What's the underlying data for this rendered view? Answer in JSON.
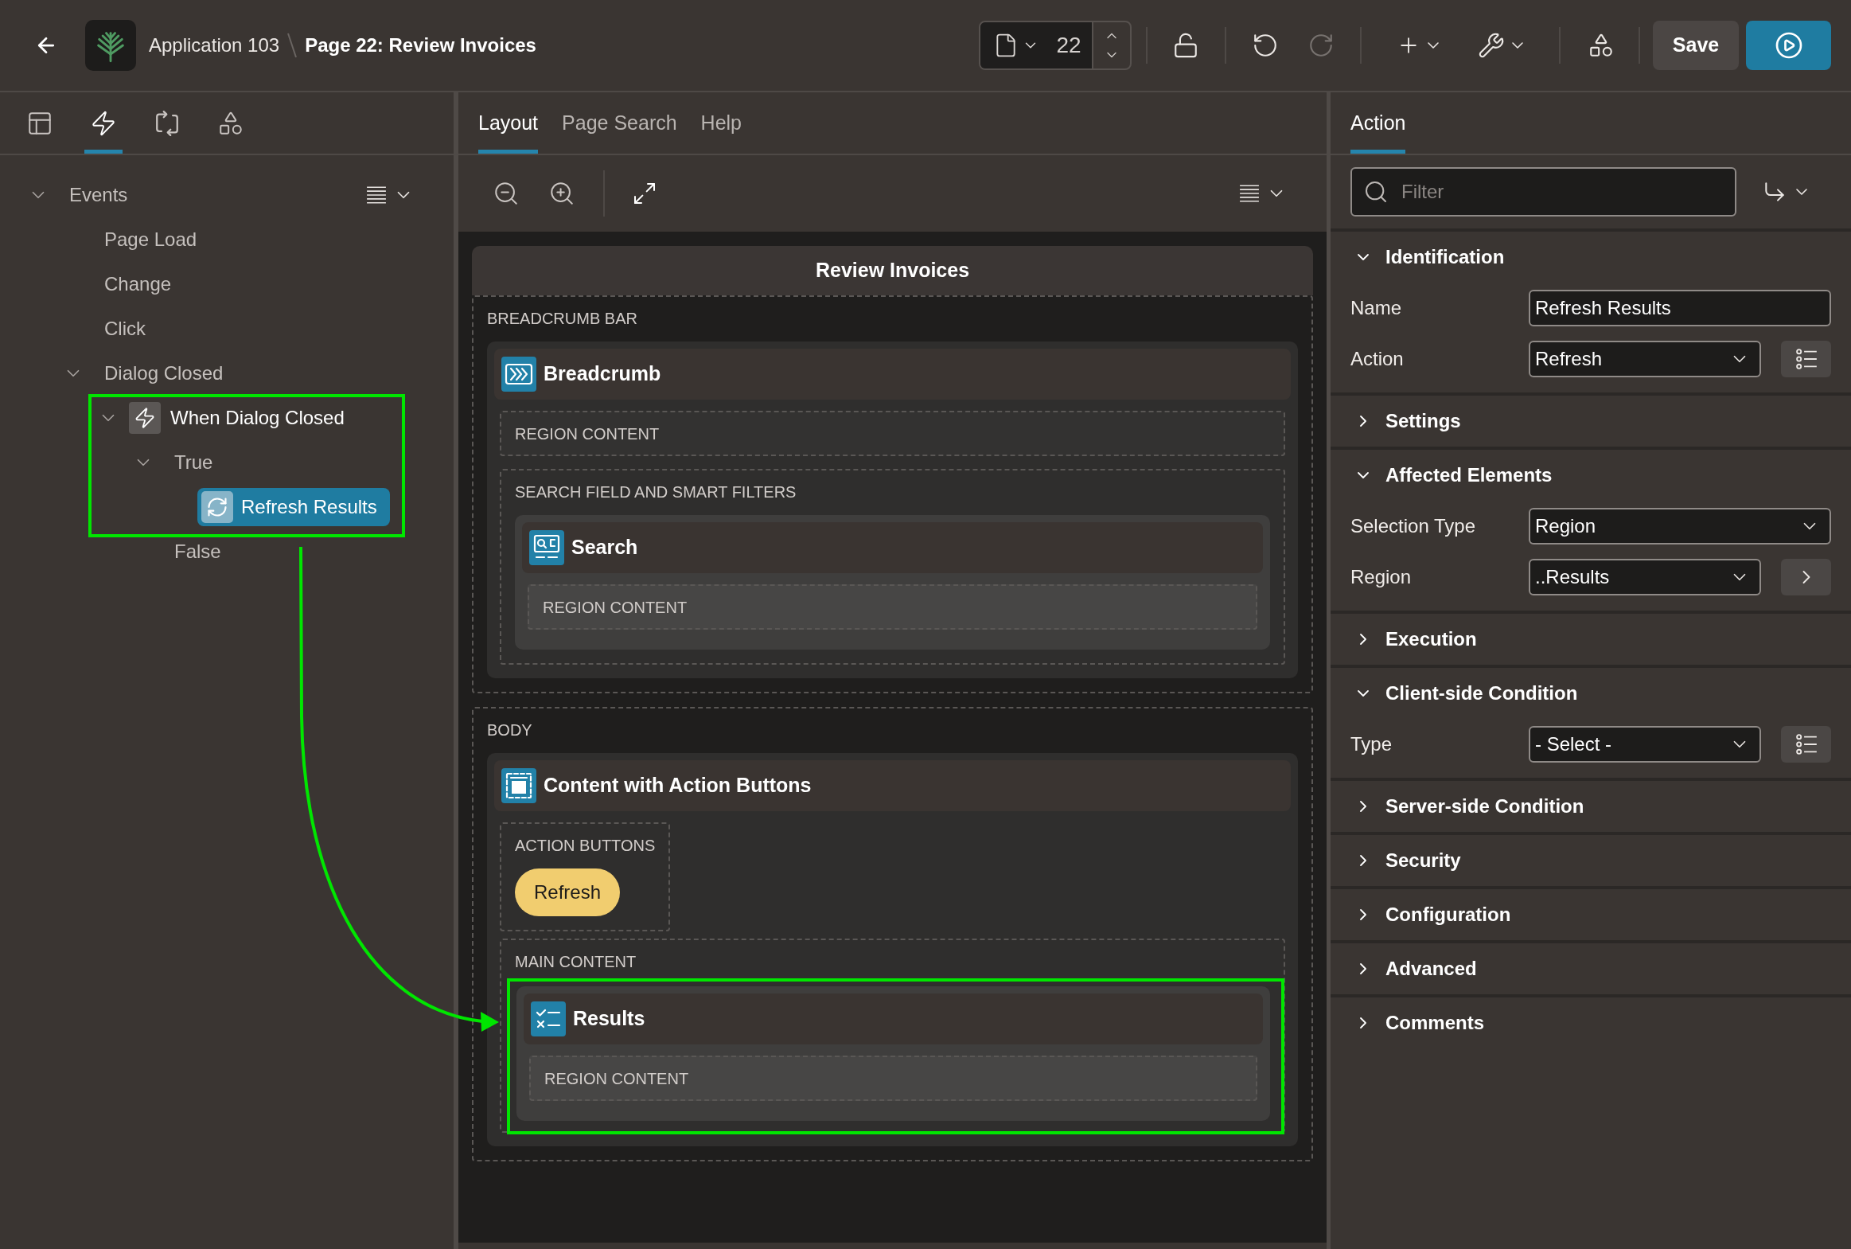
{
  "header": {
    "app_name": "Application 103",
    "page_title": "Page 22: Review Invoices",
    "page_number": "22",
    "undo": {
      "disabled": false
    },
    "redo": {
      "disabled": true
    },
    "save": "Save"
  },
  "left_panel": {
    "tabs": [
      {
        "kind": "rendering",
        "selected": false
      },
      {
        "kind": "dynamic-actions",
        "selected": true
      },
      {
        "kind": "processing",
        "selected": false
      },
      {
        "kind": "shared-components",
        "selected": false
      }
    ],
    "tree": [
      {
        "label": "Events",
        "kind": "group",
        "expanded": true,
        "selected": false,
        "highlighted": false,
        "children": [
          {
            "label": "Page Load",
            "kind": "group",
            "selected": false,
            "highlighted": false
          },
          {
            "label": "Change",
            "kind": "group",
            "selected": false,
            "highlighted": false
          },
          {
            "label": "Click",
            "kind": "group",
            "selected": false,
            "highlighted": false
          },
          {
            "label": "Dialog Closed",
            "kind": "group",
            "expanded": true,
            "selected": false,
            "highlighted": false,
            "children": [
              {
                "label": "When Dialog Closed",
                "kind": "dynamic-action",
                "expanded": true,
                "selected": false,
                "highlighted": true,
                "children": [
                  {
                    "label": "True",
                    "kind": "branch",
                    "expanded": true,
                    "selected": false,
                    "highlighted": true,
                    "children": [
                      {
                        "label": "Refresh Results",
                        "kind": "action",
                        "selected": true,
                        "highlighted": true
                      }
                    ]
                  },
                  {
                    "label": "False",
                    "kind": "branch",
                    "selected": false,
                    "highlighted": false
                  }
                ]
              }
            ]
          }
        ]
      }
    ]
  },
  "center_panel": {
    "tabs": [
      {
        "label": "Layout",
        "selected": true
      },
      {
        "label": "Page Search",
        "selected": false
      },
      {
        "label": "Help",
        "selected": false
      }
    ],
    "canvas": {
      "title": "Review Invoices",
      "positions": [
        {
          "label": "BREADCRUMB BAR",
          "regions": [
            {
              "title": "Breadcrumb",
              "kind": "breadcrumb",
              "highlighted": false,
              "slots": [
                {
                  "label": "REGION CONTENT"
                },
                {
                  "label": "SEARCH FIELD AND SMART FILTERS",
                  "regions": [
                    {
                      "title": "Search",
                      "kind": "search",
                      "highlighted": false,
                      "slots": [
                        {
                          "label": "REGION CONTENT"
                        }
                      ]
                    }
                  ]
                }
              ]
            }
          ]
        },
        {
          "label": "BODY",
          "regions": [
            {
              "title": "Content with Action Buttons",
              "kind": "content",
              "highlighted": false,
              "slots": [
                {
                  "label": "ACTION BUTTONS",
                  "buttons": [
                    {
                      "label": "Refresh"
                    }
                  ]
                },
                {
                  "label": "MAIN CONTENT",
                  "regions": [
                    {
                      "title": "Results",
                      "kind": "results",
                      "highlighted": true,
                      "slots": [
                        {
                          "label": "REGION CONTENT"
                        }
                      ]
                    }
                  ]
                }
              ]
            }
          ]
        }
      ]
    }
  },
  "right_panel": {
    "tabs": [
      {
        "label": "Action",
        "selected": true
      }
    ],
    "filter": {
      "placeholder": "Filter"
    },
    "sections": [
      {
        "title": "Identification",
        "expanded": true,
        "fields": [
          {
            "label": "Name",
            "kind": "text",
            "value": "Refresh Results"
          },
          {
            "label": "Action",
            "kind": "select",
            "value": "Refresh",
            "side_button": {
              "kind": "list"
            }
          }
        ]
      },
      {
        "title": "Settings",
        "expanded": false
      },
      {
        "title": "Affected Elements",
        "expanded": true,
        "fields": [
          {
            "label": "Selection Type",
            "kind": "select",
            "value": "Region"
          },
          {
            "label": "Region",
            "kind": "select",
            "value": "..Results",
            "side_button": {
              "kind": "next"
            }
          }
        ]
      },
      {
        "title": "Execution",
        "expanded": false
      },
      {
        "title": "Client-side Condition",
        "expanded": true,
        "fields": [
          {
            "label": "Type",
            "kind": "select",
            "value": "- Select -",
            "side_button": {
              "kind": "list"
            }
          }
        ]
      },
      {
        "title": "Server-side Condition",
        "expanded": false
      },
      {
        "title": "Security",
        "expanded": false
      },
      {
        "title": "Configuration",
        "expanded": false
      },
      {
        "title": "Advanced",
        "expanded": false
      },
      {
        "title": "Comments",
        "expanded": false
      }
    ]
  }
}
